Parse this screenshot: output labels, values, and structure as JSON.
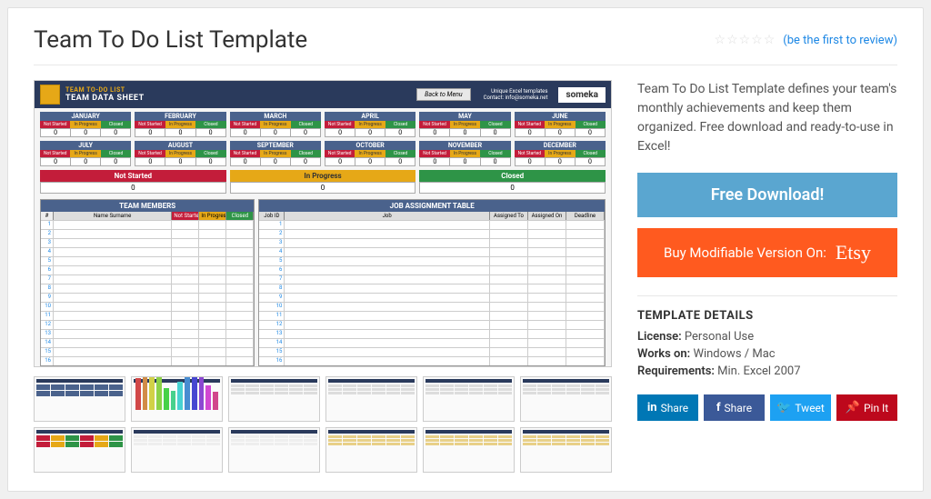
{
  "title": "Team To Do List Template",
  "review_link": "(be the first to review)",
  "description": "Team To Do List Template defines your team's monthly achievements and keep them organized. Free download and ready-to-use in Excel!",
  "download_btn": "Free Download!",
  "buy_btn": "Buy Modifiable Version On:",
  "buy_brand": "Etsy",
  "preview": {
    "header_small": "TEAM TO-DO LIST",
    "header_big": "TEAM DATA SHEET",
    "back_btn": "Back to Menu",
    "meta1": "Unique Excel templates",
    "meta2": "Contact: info@someka.net",
    "logo": "someka",
    "months": [
      "JANUARY",
      "FEBRUARY",
      "MARCH",
      "APRIL",
      "MAY",
      "JUNE",
      "JULY",
      "AUGUST",
      "SEPTEMBER",
      "OCTOBER",
      "NOVEMBER",
      "DECEMBER"
    ],
    "status_labels": [
      "Not Started",
      "In Progress",
      "Closed"
    ],
    "zero": "0",
    "summary": [
      "Not Started",
      "In Progress",
      "Closed"
    ],
    "table_members": "TEAM MEMBERS",
    "table_jobs": "JOB ASSIGNMENT TABLE",
    "cols_members": {
      "idx": "#",
      "name": "Name Surname",
      "ns": "Not Started",
      "ip": "In Progress",
      "cl": "Closed"
    },
    "cols_jobs": {
      "jid": "Job ID",
      "job": "Job",
      "asg_to": "Assigned To",
      "asg_on": "Assigned On",
      "dl": "Deadline"
    },
    "rows": [
      1,
      2,
      3,
      4,
      5,
      6,
      7,
      8,
      9,
      10,
      11,
      12,
      13,
      14,
      15,
      16
    ]
  },
  "details": {
    "heading": "TEMPLATE DETAILS",
    "license_k": "License:",
    "license_v": "Personal Use",
    "works_k": "Works on:",
    "works_v": "Windows / Mac",
    "req_k": "Requirements:",
    "req_v": "Min. Excel 2007"
  },
  "socials": {
    "linkedin": "Share",
    "facebook": "Share",
    "twitter": "Tweet",
    "pinterest": "Pin It"
  }
}
